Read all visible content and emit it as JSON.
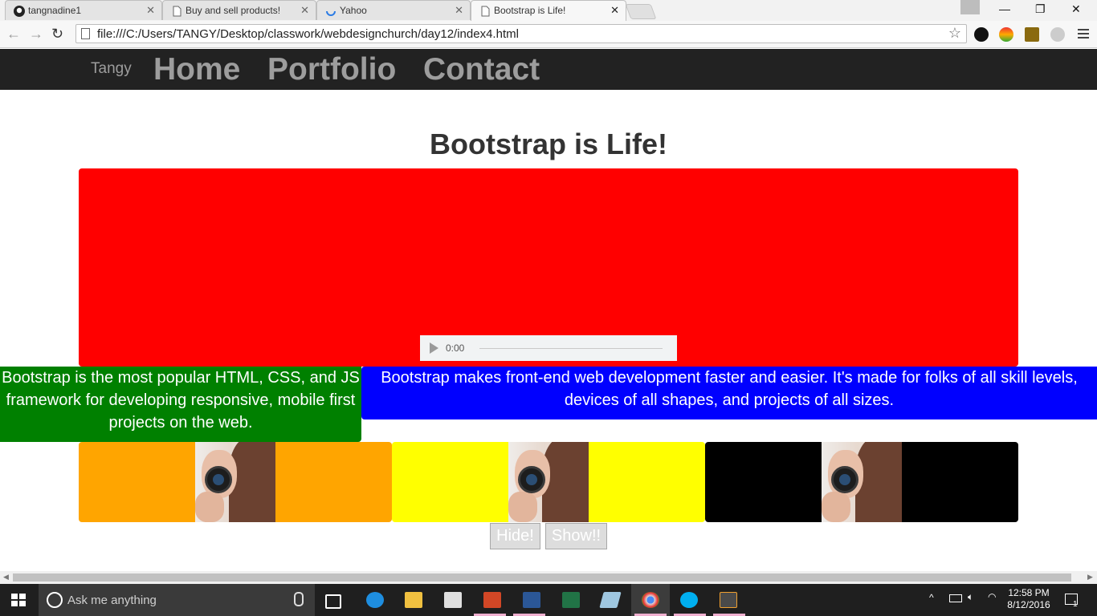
{
  "browser": {
    "tabs": [
      {
        "title": "tangnadine1",
        "icon": "github-icon"
      },
      {
        "title": "Buy and sell products!",
        "icon": "page-icon"
      },
      {
        "title": "Yahoo",
        "icon": "loading-icon"
      },
      {
        "title": "Bootstrap is Life!",
        "icon": "page-icon",
        "active": true
      }
    ],
    "close_glyph": "✕",
    "url": "file:///C:/Users/TANGY/Desktop/classwork/webdesignchurch/day12/index4.html"
  },
  "site": {
    "brand": "Tangy",
    "nav": [
      "Home",
      "Portfolio",
      "Contact"
    ],
    "title": "Bootstrap is Life!",
    "video": {
      "time": "0:00",
      "color": "#ff0000"
    },
    "green_text": "Bootstrap is the most popular HTML, CSS, and JS framework for developing responsive, mobile first projects on the web.",
    "blue_text": "Bootstrap makes front-end web development faster and easier. It's made for folks of all skill levels, devices of all shapes, and projects of all sizes.",
    "panels": [
      {
        "color": "#ffa500",
        "image": "woman-with-camera-photo"
      },
      {
        "color": "#ffff00",
        "image": "woman-with-camera-photo"
      },
      {
        "color": "#000000",
        "image": "woman-with-camera-photo"
      }
    ],
    "buttons": {
      "hide": "Hide!",
      "show": "Show!!"
    }
  },
  "taskbar": {
    "search_placeholder": "Ask me anything",
    "time": "12:58 PM",
    "date": "8/12/2016",
    "notification_count": "1"
  }
}
